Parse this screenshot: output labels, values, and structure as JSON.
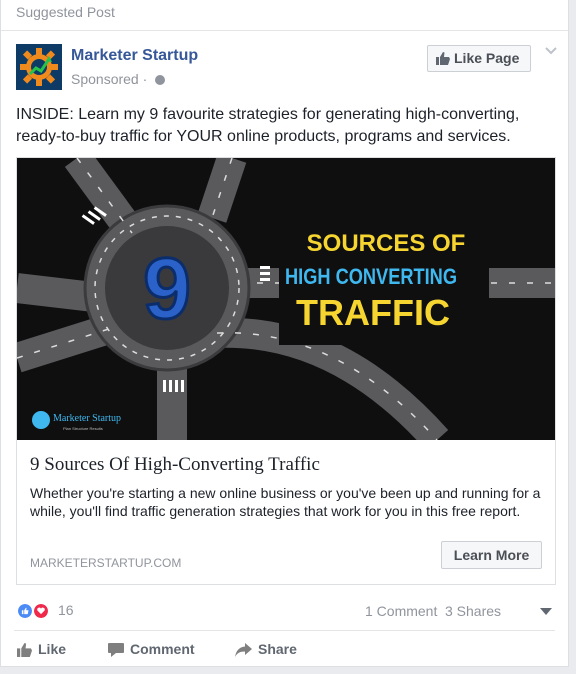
{
  "header": {
    "suggested_label": "Suggested Post"
  },
  "page": {
    "name": "Marketer Startup",
    "sponsored_label": "Sponsored",
    "separator": "·",
    "like_page_label": "Like Page"
  },
  "post": {
    "text": "INSIDE: Learn my 9 favourite strategies for generating high-converting, ready-to-buy traffic for YOUR online products, programs and services."
  },
  "image": {
    "number": "9",
    "line1": "SOURCES OF",
    "line2": "HIGH CONVERTING",
    "line3": "TRAFFIC",
    "brand_main": "Marketer Startup",
    "brand_sub": "Plan Structure Results"
  },
  "link": {
    "title": "9 Sources Of High-Converting Traffic",
    "description": "Whether you're starting a new online business or you've been up and running for a while, you'll find traffic generation strategies that work for you in this free report.",
    "domain": "MARKETERSTARTUP.COM",
    "cta_label": "Learn More"
  },
  "engagement": {
    "reaction_count": "16",
    "comments": "1 Comment",
    "shares": "3 Shares"
  },
  "actions": {
    "like": "Like",
    "comment": "Comment",
    "share": "Share"
  },
  "colors": {
    "link_blue": "#365899",
    "accent_yellow": "#f7d531",
    "accent_blue": "#2a62c9",
    "like_blue": "#4c8bf5",
    "love_red": "#f0284a"
  }
}
